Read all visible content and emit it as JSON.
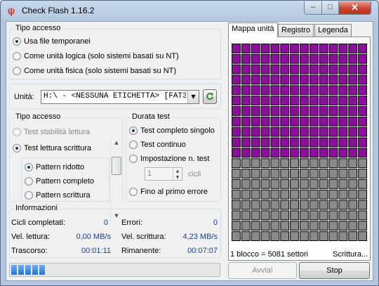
{
  "window": {
    "title": "Check Flash 1.16.2",
    "minimize": "–",
    "maximize": "□",
    "close": "✕"
  },
  "access_type": {
    "legend": "Tipo accesso",
    "options": [
      "Usa file temporanei",
      "Come unità logica (solo sistemi basati su NT)",
      "Come unità fisica (solo sistemi basati su NT)"
    ]
  },
  "drive": {
    "label": "Unità:",
    "value": "H:\\ - <NESSUNA ETICHETTA> [FAT32]",
    "refresh_icon": "refresh-icon"
  },
  "test_type": {
    "legend": "Tipo accesso",
    "options": [
      "Test stabilità lettura",
      "Test lettura scrittura"
    ],
    "patterns": [
      "Pattern ridotto",
      "Pattern completo",
      "Pattern scrittura"
    ]
  },
  "duration": {
    "legend": "Durata test",
    "options": [
      "Test completo singolo",
      "Test continuo",
      "Impostazione n. test",
      "Fino al primo errore"
    ],
    "cycles_value": "1",
    "cycles_label": "cicli"
  },
  "info": {
    "legend": "Informazioni",
    "cycles_label": "Cicli completati:",
    "cycles_value": "0",
    "errors_label": "Errori:",
    "errors_value": "0",
    "read_label": "Vel. lettura:",
    "read_value": "0,00 MB/s",
    "write_label": "Vel. scrittura:",
    "write_value": "4,23 MB/s",
    "elapsed_label": "Trascorso:",
    "elapsed_value": "00:01:11",
    "remaining_label": "Rimanente:",
    "remaining_value": "00:07:07"
  },
  "tabs": [
    "Mappa unità",
    "Registro",
    "Legenda"
  ],
  "map": {
    "block_info": "1 blocco = 5081 settori",
    "status": "Scrittura...",
    "columns": 14,
    "rows": 19,
    "written_rows": 11,
    "colors": {
      "written": "#8b0f9b",
      "pending": "#8a8a8a",
      "border": "#000000"
    }
  },
  "progress": {
    "fraction": 0.18
  },
  "buttons": {
    "start": "Avvia!",
    "stop": "Stop"
  }
}
